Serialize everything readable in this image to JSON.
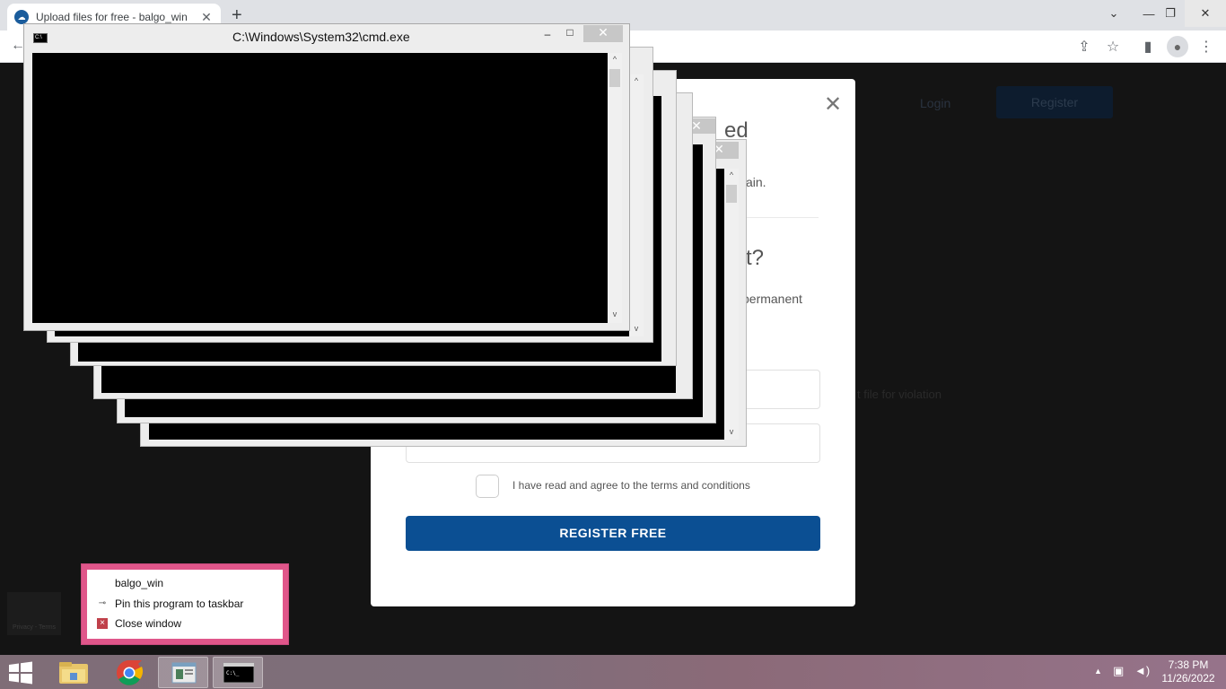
{
  "browser": {
    "tab_title": "Upload files for free - balgo_win",
    "tab_close": "✕",
    "new_tab": "+",
    "window_controls": [
      "⌄",
      "—",
      "❐",
      "✕"
    ]
  },
  "page": {
    "nav": {
      "login": "Login",
      "register": "Register"
    },
    "background_text": "t file for violation",
    "captcha_text": "Privacy - Terms"
  },
  "modal": {
    "close": "✕",
    "fragments": {
      "heading_tail": "ed",
      "line1_tail": "ain.",
      "question_tail": "t?",
      "line2_tail": "permanent"
    },
    "terms_label": "I have read and agree to the terms and conditions",
    "register_button": "REGISTER FREE"
  },
  "cmd_window": {
    "title": "C:\\Windows\\System32\\cmd.exe",
    "icon_text": "C:\\",
    "minimize": "–",
    "maximize": "□",
    "close": "✕",
    "scroll_up": "^",
    "scroll_down": "v"
  },
  "jump_list": {
    "app_name": "balgo_win",
    "pin": "Pin this program to taskbar",
    "close_window": "Close window"
  },
  "taskbar": {
    "time": "7:38 PM",
    "date": "11/26/2022",
    "tray_show_hidden": "▲"
  }
}
